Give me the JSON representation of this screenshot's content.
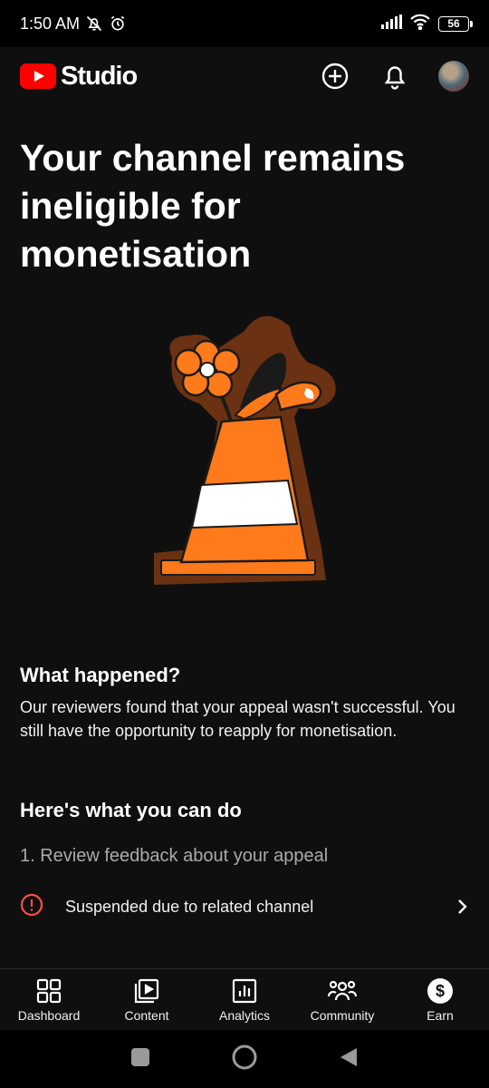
{
  "status_bar": {
    "time": "1:50 AM",
    "battery": "56",
    "icons": [
      "mute-icon",
      "alarm-icon",
      "signal-icon",
      "wifi-icon",
      "battery-icon"
    ]
  },
  "header": {
    "logo_text": "Studio",
    "brand_color": "#ff0000",
    "actions": [
      "create-icon",
      "bell-icon",
      "avatar"
    ]
  },
  "main": {
    "headline": "Your channel remains ineligible for monetisation",
    "illustration": "traffic-cone-with-flower",
    "what_happened": {
      "title": "What happened?",
      "body": "Our reviewers found that your appeal wasn't successful. You still have the opportunity to reapply for monetisation."
    },
    "next_steps": {
      "title": "Here's what you can do",
      "step1": "1. Review feedback about your appeal",
      "feedback_item": "Suspended due to related channel",
      "alert_color": "#ff4e45"
    }
  },
  "bottom_nav": {
    "items": [
      {
        "label": "Dashboard",
        "icon": "dashboard-icon"
      },
      {
        "label": "Content",
        "icon": "content-icon"
      },
      {
        "label": "Analytics",
        "icon": "analytics-icon"
      },
      {
        "label": "Community",
        "icon": "community-icon"
      },
      {
        "label": "Earn",
        "icon": "earn-icon"
      }
    ]
  },
  "system_nav": [
    "recents-icon",
    "home-icon",
    "back-icon"
  ]
}
